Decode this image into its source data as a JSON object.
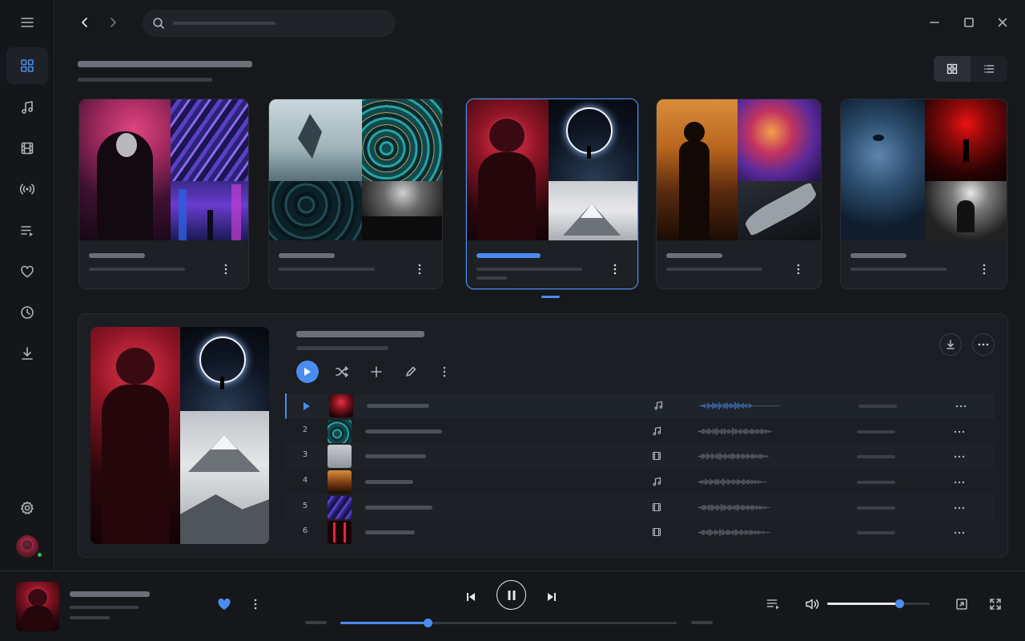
{
  "colors": {
    "accent": "#4a8cf0",
    "background": "#16181c",
    "panel": "#1b1e22",
    "card": "#1d2025",
    "online": "#2fbf5b"
  },
  "sidebar": {
    "items": [
      {
        "name": "library",
        "icon": "grid-icon",
        "active": true
      },
      {
        "name": "music",
        "icon": "music-note-icon",
        "active": false
      },
      {
        "name": "videos",
        "icon": "film-icon",
        "active": false
      },
      {
        "name": "radio",
        "icon": "broadcast-icon",
        "active": false
      },
      {
        "name": "playlists",
        "icon": "playlist-icon",
        "active": false
      },
      {
        "name": "favorites",
        "icon": "heart-icon",
        "active": false
      },
      {
        "name": "recent",
        "icon": "clock-icon",
        "active": false
      },
      {
        "name": "downloads",
        "icon": "download-icon",
        "active": false
      }
    ],
    "bottom": [
      {
        "name": "settings",
        "icon": "gear-icon"
      },
      {
        "name": "profile",
        "icon": "avatar",
        "status": "online"
      }
    ]
  },
  "topbar": {
    "nav": [
      "back-arrow-icon",
      "forward-arrow-icon"
    ],
    "search": {
      "icon": "search-icon",
      "value": "",
      "placeholder": ""
    },
    "window_controls": [
      "minimize-icon",
      "maximize-icon",
      "close-icon"
    ]
  },
  "view_toggle": {
    "selected": "grid",
    "options": [
      "grid",
      "list"
    ]
  },
  "playlists": [
    {
      "id": 1,
      "selected": false,
      "collage": [
        "headphones-girl",
        "purple-waves",
        "neon-city",
        ""
      ]
    },
    {
      "id": 2,
      "selected": false,
      "collage": [
        "floating-rock",
        "teal-swirl",
        "dark-ocean",
        "concert-crowd"
      ]
    },
    {
      "id": 3,
      "selected": true,
      "collage": [
        "red-astronaut",
        "ring-portal",
        "",
        "snowy-mountain"
      ]
    },
    {
      "id": 4,
      "selected": false,
      "collage": [
        "sunset-silhouette",
        "nebula",
        "",
        "spaceship"
      ]
    },
    {
      "id": 5,
      "selected": false,
      "collage": [
        "blue-face",
        "red-corridor",
        "",
        "drummer"
      ]
    }
  ],
  "detail": {
    "actions": [
      "play-icon",
      "shuffle-icon",
      "plus-icon",
      "pencil-icon",
      "more-vertical-icon"
    ],
    "corner_actions": [
      "download-icon",
      "more-horizontal-icon"
    ],
    "tracks": [
      {
        "num": "",
        "playing": true,
        "type": "audio",
        "thumb": "red-astronaut"
      },
      {
        "num": "2",
        "playing": false,
        "type": "audio",
        "thumb": "teal-swirl"
      },
      {
        "num": "3",
        "playing": false,
        "type": "video",
        "thumb": "snowy-mountain"
      },
      {
        "num": "4",
        "playing": false,
        "type": "audio",
        "thumb": "sunset-silhouette"
      },
      {
        "num": "5",
        "playing": false,
        "type": "video",
        "thumb": "purple-waves"
      },
      {
        "num": "6",
        "playing": false,
        "type": "video",
        "thumb": "red-corridor"
      }
    ]
  },
  "player": {
    "liked": true,
    "state": "playing",
    "progress": 0.26,
    "volume": 0.7,
    "controls": [
      "previous-icon",
      "pause-icon",
      "next-icon"
    ],
    "right_controls": [
      "queue-icon",
      "volume-icon",
      "miniplayer-icon",
      "fullscreen-icon"
    ]
  }
}
